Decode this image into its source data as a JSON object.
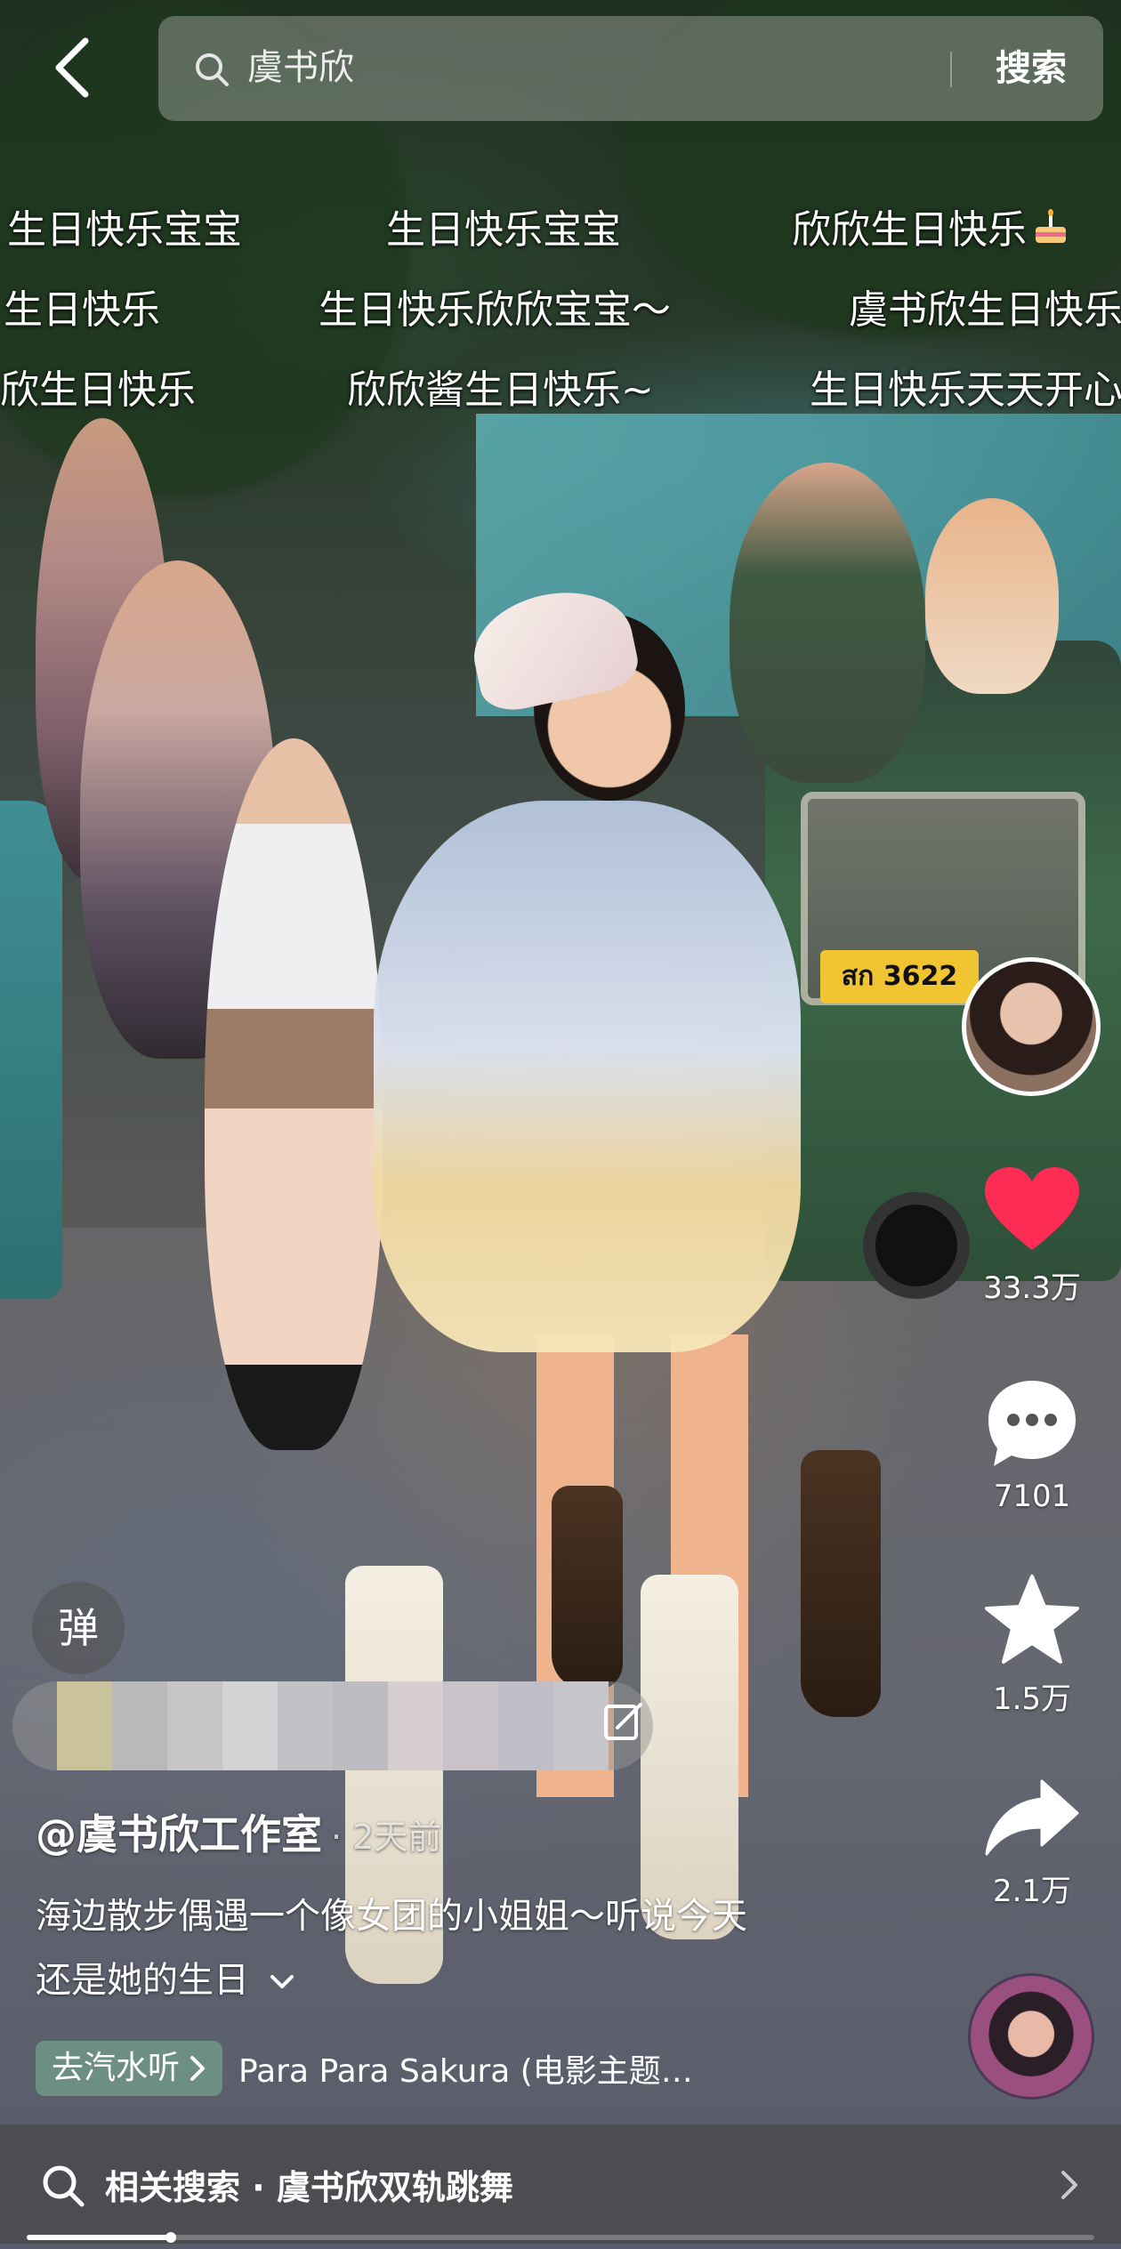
{
  "search": {
    "query": "虞书欣",
    "button_label": "搜索"
  },
  "danmaku": [
    "生日快乐宝宝",
    "生日快乐宝宝",
    "欣欣生日快乐",
    "生日快乐",
    "生日快乐欣欣宝宝～",
    "虞书欣生日快乐",
    "欣生日快乐",
    "欣欣酱生日快乐~",
    "生日快乐天天开心"
  ],
  "video": {
    "plate_text": "สก 3622"
  },
  "actions": {
    "likes": "33.3万",
    "comments": "7101",
    "favorites": "1.5万",
    "shares": "2.1万"
  },
  "danmu_toggle_label": "弹",
  "post": {
    "author": "@虞书欣工作室",
    "time_ago": "· 2天前",
    "caption_line1": "海边散步偶遇一个像女团的小姐姐～听说今天",
    "caption_line2": "还是她的生日"
  },
  "music": {
    "source_button": "去汽水听",
    "song": "Para Para Sakura (电影主题…"
  },
  "related_search": {
    "text": "相关搜索 · 虞书欣双轨跳舞"
  },
  "progress": {
    "fraction": 0.135
  },
  "colors": {
    "like": "#fe2c55",
    "accent_badge": "#5cae86"
  },
  "icons": [
    "back-icon",
    "search-icon",
    "heart-icon",
    "comment-icon",
    "star-icon",
    "share-icon",
    "edit-icon",
    "chevron-down-icon",
    "chevron-right-icon",
    "cake-icon"
  ]
}
